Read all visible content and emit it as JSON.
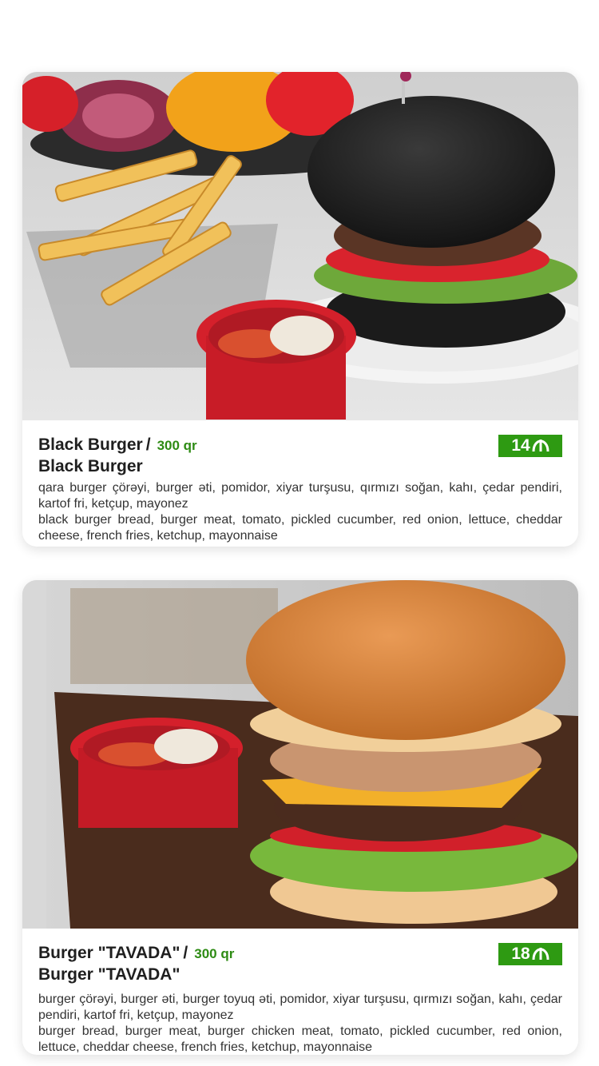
{
  "items": [
    {
      "title_az": "Black Burger",
      "title_en": "Black Burger",
      "weight": "300 qr",
      "price": "14",
      "currency_icon": "manat-icon",
      "desc_az": "qara burger çörəyi, burger əti, pomidor, xiyar turşusu, qırmızı soğan, kahı, çedar pendiri, kartof fri, ketçup, mayonez",
      "desc_en": "black burger bread, burger meat, tomato, pickled cucumber, red onion, lettuce, cheddar cheese, french fries, ketchup, mayonnaise"
    },
    {
      "title_az": "Burger \"TAVADA\"",
      "title_en": "Burger \"TAVADA\"",
      "weight": "300 qr",
      "price": "18",
      "currency_icon": "manat-icon",
      "desc_az": "burger çörəyi, burger əti, burger toyuq əti, pomidor, xiyar turşusu, qırmızı soğan, kahı, çedar pendiri, kartof fri, ketçup, mayonez",
      "desc_en": "burger bread, burger meat, burger chicken meat, tomato, pickled cucumber, red onion, lettuce, cheddar cheese, french fries, ketchup, mayonnaise"
    }
  ],
  "colors": {
    "accent_green": "#2e9a12",
    "weight_green": "#2e8b14"
  }
}
